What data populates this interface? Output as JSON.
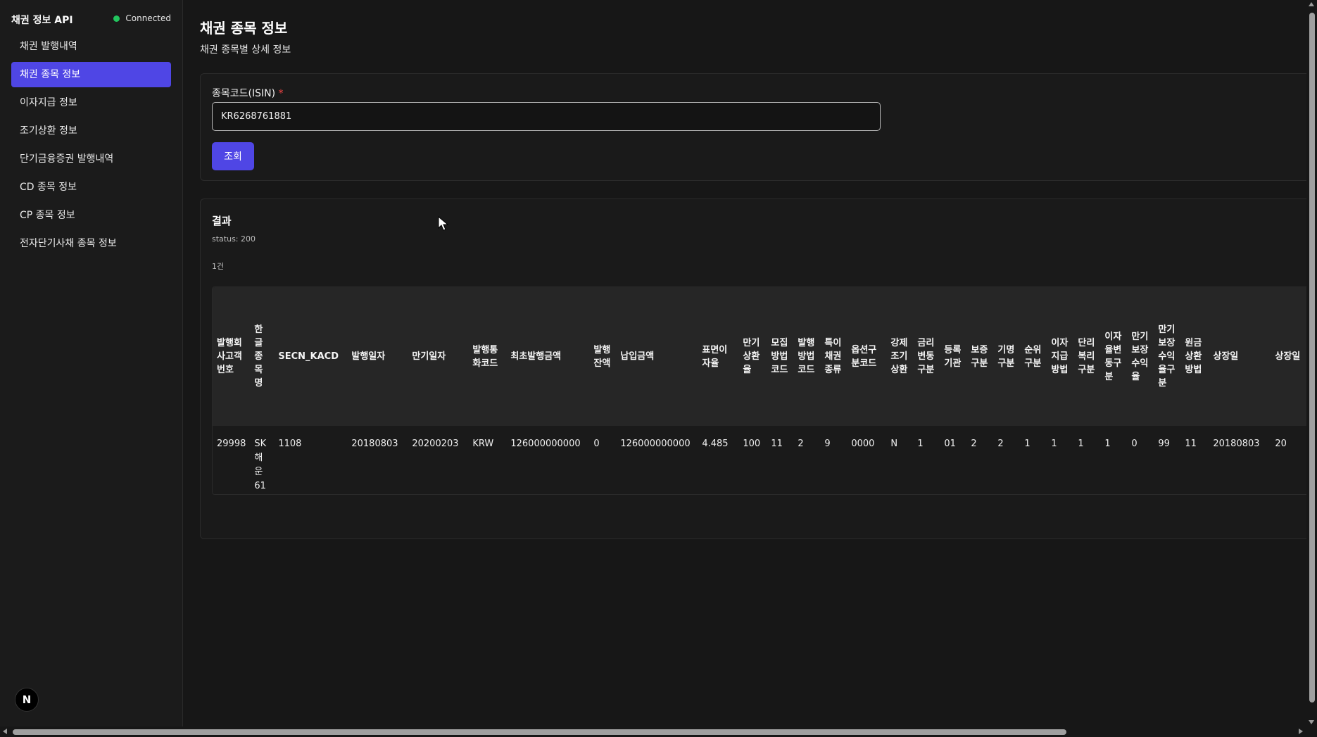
{
  "sidebar": {
    "title": "채권 정보 API",
    "status": "Connected",
    "items": [
      {
        "label": "채권 발행내역"
      },
      {
        "label": "채권 종목 정보",
        "active": true
      },
      {
        "label": "이자지급 정보"
      },
      {
        "label": "조기상환 정보"
      },
      {
        "label": "단기금융증권 발행내역"
      },
      {
        "label": "CD 종목 정보"
      },
      {
        "label": "CP 종목 정보"
      },
      {
        "label": "전자단기사채 종목 정보"
      }
    ],
    "avatar": "N"
  },
  "header": {
    "title": "채권 종목 정보",
    "subtitle": "채권 종목별 상세 정보"
  },
  "form": {
    "label": "종목코드(ISIN)",
    "required_mark": "*",
    "isin_value": "KR6268761881",
    "submit_label": "조회"
  },
  "result": {
    "title": "결과",
    "status": "status: 200",
    "count": "1건",
    "columns": [
      "발행회사고객번호",
      "한글종목명",
      "SECN_KACD",
      "발행일자",
      "만기일자",
      "발행통화코드",
      "최초발행금액",
      "발행잔액",
      "납입금액",
      "표면이자율",
      "만기상환율",
      "모집방법코드",
      "발행방법코드",
      "특이채권종류",
      "옵션구분코드",
      "강제조기상환",
      "금리변동구분",
      "등록기관",
      "보증구분",
      "기명구분",
      "순위구분",
      "이자지급방법",
      "단리복리구분",
      "이자율변동구분",
      "만기보장수익율",
      "만기보장수익율구분",
      "원금상환방법",
      "상장일",
      "상장일"
    ],
    "rows": [
      [
        "29998",
        "SK해운61",
        "1108",
        "20180803",
        "20200203",
        "KRW",
        "126000000000",
        "0",
        "126000000000",
        "4.485",
        "100",
        "11",
        "2",
        "9",
        "0000",
        "N",
        "1",
        "01",
        "2",
        "2",
        "1",
        "1",
        "1",
        "1",
        "0",
        "99",
        "11",
        "20180803",
        "20"
      ]
    ]
  },
  "colors": {
    "accent": "#4f46e5",
    "connected": "#22c55e",
    "required": "#ef4444"
  }
}
